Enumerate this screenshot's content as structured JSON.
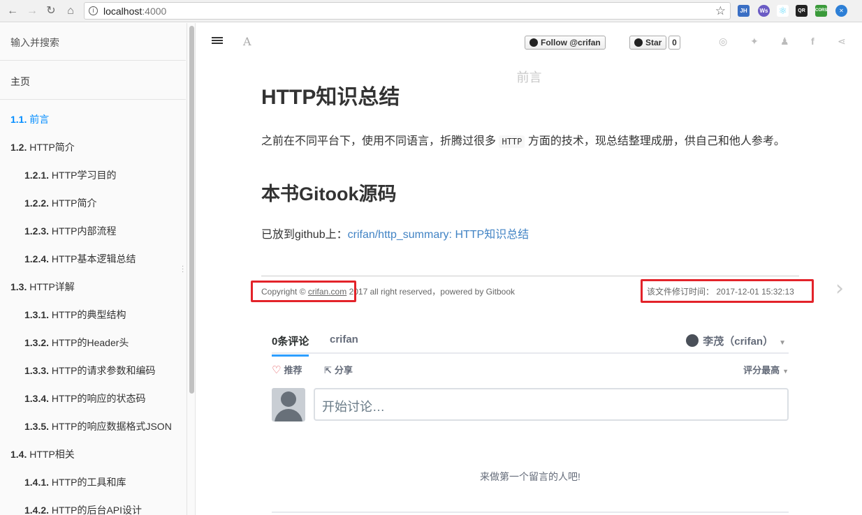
{
  "browser": {
    "url_host": "localhost",
    "url_port": ":4000",
    "extensions": [
      "JH",
      "Ws",
      "⚛",
      "QR",
      "CORS",
      "✕"
    ]
  },
  "sidebar": {
    "search_placeholder": "输入并搜索",
    "home_label": "主页",
    "items": [
      {
        "num": "1.1.",
        "label": "前言",
        "level": 1,
        "active": true
      },
      {
        "num": "1.2.",
        "label": "HTTP简介",
        "level": 1
      },
      {
        "num": "1.2.1.",
        "label": "HTTP学习目的",
        "level": 2
      },
      {
        "num": "1.2.2.",
        "label": "HTTP简介",
        "level": 2
      },
      {
        "num": "1.2.3.",
        "label": "HTTP内部流程",
        "level": 2
      },
      {
        "num": "1.2.4.",
        "label": "HTTP基本逻辑总结",
        "level": 2
      },
      {
        "num": "1.3.",
        "label": "HTTP详解",
        "level": 1
      },
      {
        "num": "1.3.1.",
        "label": "HTTP的典型结构",
        "level": 2
      },
      {
        "num": "1.3.2.",
        "label": "HTTP的Header头",
        "level": 2
      },
      {
        "num": "1.3.3.",
        "label": "HTTP的请求参数和编码",
        "level": 2
      },
      {
        "num": "1.3.4.",
        "label": "HTTP的响应的状态码",
        "level": 2
      },
      {
        "num": "1.3.5.",
        "label": "HTTP的响应数据格式JSON",
        "level": 2
      },
      {
        "num": "1.4.",
        "label": "HTTP相关",
        "level": 1
      },
      {
        "num": "1.4.1.",
        "label": "HTTP的工具和库",
        "level": 2
      },
      {
        "num": "1.4.2.",
        "label": "HTTP的后台API设计",
        "level": 2
      }
    ]
  },
  "header": {
    "follow_label": "Follow @crifan",
    "star_label": "Star",
    "star_count": "0",
    "page_title": "前言"
  },
  "content": {
    "h1": "HTTP知识总结",
    "p1_before": "之前在不同平台下，使用不同语言，折腾过很多",
    "p1_code": "HTTP",
    "p1_after": "方面的技术，现总结整理成册，供自己和他人参考。",
    "h2": "本书Gitook源码",
    "p2_prefix": "已放到github上：",
    "p2_link": "crifan/http_summary: HTTP知识总结"
  },
  "footer": {
    "copyright_prefix": "Copyright © ",
    "copyright_link": "crifan.com",
    "copyright_suffix": " 2017 all right reserved，powered by Gitbook",
    "modified_label": "该文件修订时间：",
    "modified_time": "2017-12-01 15:32:13"
  },
  "comments": {
    "count_tab": "0条评论",
    "forum_tab": "crifan",
    "user": "李茂（crifan）",
    "recommend": "推荐",
    "share": "分享",
    "sort": "评分最高",
    "input_placeholder": "开始讨论…",
    "empty_text": "来做第一个留言的人吧!"
  },
  "colors": {
    "accent_link": "#4183c4",
    "active_toc": "#008cff",
    "highlight_box": "#e3232a"
  }
}
